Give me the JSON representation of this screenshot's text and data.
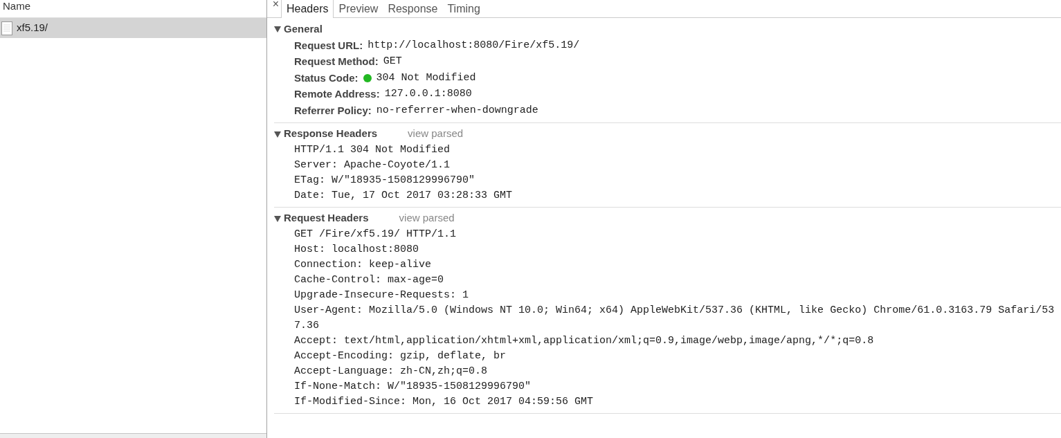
{
  "requests": {
    "column_header": "Name",
    "items": [
      {
        "name": "xf5.19/",
        "selected": true
      }
    ]
  },
  "detail": {
    "close": "×",
    "tabs": [
      {
        "label": "Headers",
        "selected": true
      },
      {
        "label": "Preview",
        "selected": false
      },
      {
        "label": "Response",
        "selected": false
      },
      {
        "label": "Timing",
        "selected": false
      }
    ],
    "sections": [
      {
        "kind": "pairs",
        "title": "General",
        "expanded": true,
        "rows": [
          {
            "key": "Request URL:",
            "value": "http://localhost:8080/Fire/xf5.19/"
          },
          {
            "key": "Request Method:",
            "value": "GET"
          },
          {
            "key": "Status Code:",
            "value": "304 Not Modified",
            "color": "#22b822"
          },
          {
            "key": "Remote Address:",
            "value": "127.0.0.1:8080"
          },
          {
            "key": "Referrer Policy:",
            "value": "no-referrer-when-downgrade"
          }
        ]
      },
      {
        "kind": "lines",
        "title": "Response Headers",
        "expanded": true,
        "link": "view parsed",
        "lines": [
          "HTTP/1.1 304 Not Modified",
          "Server: Apache-Coyote/1.1",
          "ETag: W/\"18935-1508129996790\"",
          "Date: Tue, 17 Oct 2017 03:28:33 GMT"
        ]
      },
      {
        "kind": "lines",
        "title": "Request Headers",
        "expanded": true,
        "link": "view parsed",
        "lines": [
          "GET /Fire/xf5.19/ HTTP/1.1",
          "Host: localhost:8080",
          "Connection: keep-alive",
          "Cache-Control: max-age=0",
          "Upgrade-Insecure-Requests: 1",
          "User-Agent: Mozilla/5.0 (Windows NT 10.0; Win64; x64) AppleWebKit/537.36 (KHTML, like Gecko) Chrome/61.0.3163.79 Safari/537.36",
          "Accept: text/html,application/xhtml+xml,application/xml;q=0.9,image/webp,image/apng,*/*;q=0.8",
          "Accept-Encoding: gzip, deflate, br",
          "Accept-Language: zh-CN,zh;q=0.8",
          "If-None-Match: W/\"18935-1508129996790\"",
          "If-Modified-Since: Mon, 16 Oct 2017 04:59:56 GMT"
        ]
      }
    ]
  }
}
